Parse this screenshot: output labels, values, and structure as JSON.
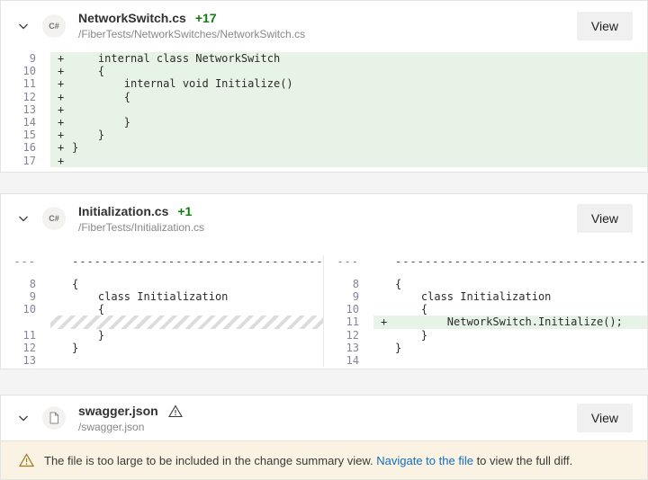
{
  "colors": {
    "added_line_bg": "#e8f3e8",
    "added_count_green": "#107c10",
    "banner_bg": "#faf2e3",
    "link_blue": "#106ebe"
  },
  "files": [
    {
      "name": "NetworkSwitch.cs",
      "change_count": "+17",
      "path": "/FiberTests/NetworkSwitches/NetworkSwitch.cs",
      "view_label": "View",
      "file_icon_label": "C#",
      "diff": {
        "type": "unified",
        "rows": [
          {
            "num": "9",
            "marker": "+",
            "kind": "added",
            "code": "    internal class NetworkSwitch"
          },
          {
            "num": "10",
            "marker": "+",
            "kind": "added",
            "code": "    {"
          },
          {
            "num": "11",
            "marker": "+",
            "kind": "added",
            "code": "        internal void Initialize()"
          },
          {
            "num": "12",
            "marker": "+",
            "kind": "added",
            "code": "        {"
          },
          {
            "num": "13",
            "marker": "+",
            "kind": "added",
            "code": ""
          },
          {
            "num": "14",
            "marker": "+",
            "kind": "added",
            "code": "        }"
          },
          {
            "num": "15",
            "marker": "+",
            "kind": "added",
            "code": "    }"
          },
          {
            "num": "16",
            "marker": "+",
            "kind": "added",
            "code": "}"
          },
          {
            "num": "17",
            "marker": "+",
            "kind": "added",
            "code": ""
          }
        ]
      }
    },
    {
      "name": "Initialization.cs",
      "change_count": "+1",
      "path": "/FiberTests/Initialization.cs",
      "view_label": "View",
      "file_icon_label": "C#",
      "diff": {
        "type": "split",
        "left": [
          {
            "num": "---",
            "kind": "separator",
            "code": "----------------------------------------"
          },
          {
            "kind": "spacer"
          },
          {
            "num": "8",
            "kind": "context",
            "code": "{"
          },
          {
            "num": "9",
            "kind": "context",
            "code": "    class Initialization"
          },
          {
            "num": "10",
            "kind": "context",
            "code": "    {"
          },
          {
            "kind": "hatch"
          },
          {
            "num": "11",
            "kind": "context",
            "code": "    }"
          },
          {
            "num": "12",
            "kind": "context",
            "code": "}"
          },
          {
            "num": "13",
            "kind": "context",
            "code": ""
          }
        ],
        "right": [
          {
            "num": "---",
            "kind": "separator",
            "code": "----------------------------------------"
          },
          {
            "kind": "spacer"
          },
          {
            "num": "8",
            "kind": "context",
            "code": "{"
          },
          {
            "num": "9",
            "kind": "context",
            "code": "    class Initialization"
          },
          {
            "num": "10",
            "kind": "context",
            "code": "    {"
          },
          {
            "num": "11",
            "marker": "+",
            "kind": "added",
            "code": "        NetworkSwitch.Initialize();"
          },
          {
            "num": "12",
            "kind": "context",
            "code": "    }"
          },
          {
            "num": "13",
            "kind": "context",
            "code": "}"
          },
          {
            "num": "14",
            "kind": "context",
            "code": ""
          }
        ]
      }
    },
    {
      "name": "swagger.json",
      "path": "/swagger.json",
      "view_label": "View",
      "has_warning": true,
      "warning_banner": {
        "text_before_link": "The file is too large to be included in the change summary view. ",
        "link_text": "Navigate to the file",
        "text_after_link": " to view the full diff."
      }
    }
  ]
}
